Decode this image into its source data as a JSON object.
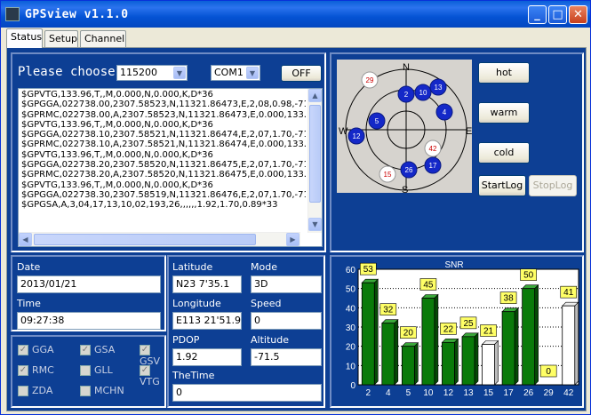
{
  "window": {
    "title": "GPSview v1.1.0",
    "minimize": "_",
    "maximize": "□",
    "close": "✕"
  },
  "tabs": [
    "Status",
    "Setup",
    "Channel"
  ],
  "serial": {
    "prompt": "Please choose:",
    "baud": "115200",
    "port": "COM1",
    "toggle": "OFF"
  },
  "log_lines": [
    "$GPVTG,133.96,T,,M,0.000,N,0.000,K,D*36",
    "$GPGGA,022738.00,2307.58523,N,11321.86473,E,2,08,0.98,-71.5,",
    "$GPRMC,022738.00,A,2307.58523,N,11321.86473,E,0.000,133.96",
    "$GPVTG,133.96,T,,M,0.000,N,0.000,K,D*36",
    "$GPGGA,022738.10,2307.58521,N,11321.86474,E,2,07,1.70,-71.5,",
    "$GPRMC,022738.10,A,2307.58521,N,11321.86474,E,0.000,133.96",
    "$GPVTG,133.96,T,,M,0.000,N,0.000,K,D*36",
    "$GPGGA,022738.20,2307.58520,N,11321.86475,E,2,07,1.70,-71.5,",
    "$GPRMC,022738.20,A,2307.58520,N,11321.86475,E,0.000,133.96",
    "$GPVTG,133.96,T,,M,0.000,N,0.000,K,D*36",
    "$GPGGA,022738.30,2307.58519,N,11321.86476,E,2,07,1.70,-71.5,",
    "$GPGSA,A,3,04,17,13,10,02,193,26,,,,,,1.92,1.70,0.89*33"
  ],
  "sky": {
    "compass": {
      "n": "N",
      "e": "E",
      "s": "S",
      "w": "W"
    },
    "satellites": [
      {
        "id": "29",
        "used": false
      },
      {
        "id": "2",
        "used": true
      },
      {
        "id": "10",
        "used": true
      },
      {
        "id": "13",
        "used": true
      },
      {
        "id": "4",
        "used": true
      },
      {
        "id": "5",
        "used": true
      },
      {
        "id": "12",
        "used": true
      },
      {
        "id": "42",
        "used": false
      },
      {
        "id": "15",
        "used": false
      },
      {
        "id": "26",
        "used": true
      },
      {
        "id": "17",
        "used": true
      }
    ]
  },
  "start_buttons": {
    "hot": "hot",
    "warm": "warm",
    "cold": "cold",
    "start_log": "StartLog",
    "stop_log": "StopLog"
  },
  "datetime": {
    "date_label": "Date",
    "date": "2013/01/21",
    "time_label": "Time",
    "time": "09:27:38"
  },
  "nmea_filters": [
    {
      "label": "GGA",
      "checked": true,
      "enabled": false
    },
    {
      "label": "GSA",
      "checked": true,
      "enabled": false
    },
    {
      "label": "GSV",
      "checked": true,
      "enabled": false
    },
    {
      "label": "RMC",
      "checked": true,
      "enabled": false
    },
    {
      "label": "GLL",
      "checked": false,
      "enabled": false
    },
    {
      "label": "VTG",
      "checked": true,
      "enabled": false
    },
    {
      "label": "ZDA",
      "checked": false,
      "enabled": false
    },
    {
      "label": "MCHN",
      "checked": false,
      "enabled": false
    }
  ],
  "position": {
    "latitude_label": "Latitude",
    "latitude": "N23   7'35.1",
    "mode_label": "Mode",
    "mode": "3D",
    "longitude_label": "Longitude",
    "longitude": "E113   21'51.9",
    "speed_label": "Speed",
    "speed": "0",
    "pdop_label": "PDOP",
    "pdop": "1.92",
    "altitude_label": "Altitude",
    "altitude": "-71.5",
    "thetime_label": "TheTime",
    "thetime": "0"
  },
  "chart_data": {
    "type": "bar",
    "title": "SNR",
    "categories": [
      "2",
      "4",
      "5",
      "10",
      "12",
      "13",
      "15",
      "17",
      "26",
      "29",
      "42"
    ],
    "values": [
      53,
      32,
      20,
      45,
      22,
      25,
      21,
      38,
      50,
      0,
      41
    ],
    "used": [
      true,
      true,
      true,
      true,
      true,
      true,
      false,
      true,
      true,
      false,
      false
    ],
    "ylim": [
      0,
      60
    ],
    "yticks": [
      "0",
      "10",
      "20",
      "30",
      "40",
      "50",
      "60"
    ],
    "colors": {
      "used": "#0a7a0a",
      "unused": "#ffffff",
      "label_bg": "#ffff66"
    }
  },
  "colors": {
    "panel_bg": "#0d3f94",
    "used_sat": "#1428c8",
    "unused_sat": "#ffffff"
  }
}
